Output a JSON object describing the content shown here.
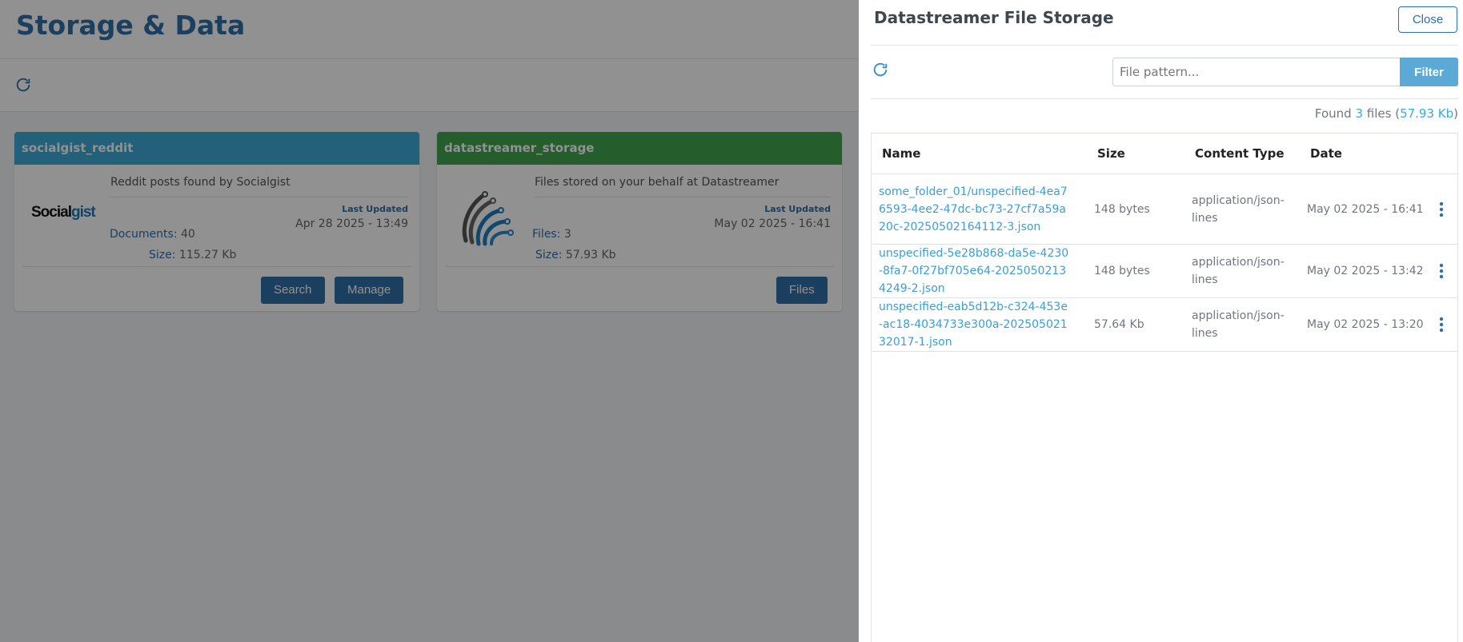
{
  "page": {
    "title": "Storage & Data"
  },
  "cards": [
    {
      "name": "socialgist_reddit",
      "description": "Reddit posts found by Socialgist",
      "logo_text_1": "Social",
      "logo_text_2": "gist",
      "stat1_label": "Documents:",
      "stat1_value": "40",
      "stat2_label": "Size:",
      "stat2_value": "115.27 Kb",
      "updated_label": "Last Updated",
      "updated_value": "Apr 28 2025 - 13:49",
      "buttons": [
        "Search",
        "Manage"
      ]
    },
    {
      "name": "datastreamer_storage",
      "description": "Files stored on your behalf at Datastreamer",
      "stat1_label": "Files:",
      "stat1_value": "3",
      "stat2_label": "Size:",
      "stat2_value": "57.93 Kb",
      "updated_label": "Last Updated",
      "updated_value": "May 02 2025 - 16:41",
      "buttons": [
        "Files"
      ]
    }
  ],
  "panel": {
    "title": "Datastreamer File Storage",
    "close_label": "Close",
    "search_placeholder": "File pattern...",
    "filter_label": "Filter",
    "found_prefix": "Found",
    "found_count": "3",
    "found_mid": "files (",
    "found_size": "57.93 Kb",
    "found_suffix": ")",
    "columns": [
      "Name",
      "Size",
      "Content Type",
      "Date"
    ],
    "rows": [
      {
        "name": "some_folder_01/unspecified-4ea76593-4ee2-47dc-bc73-27cf7a59a20c-20250502164112-3.json",
        "size": "148 bytes",
        "content_type": "application/json-lines",
        "date": "May 02 2025 - 16:41"
      },
      {
        "name": "unspecified-5e28b868-da5e-4230-8fa7-0f27bf705e64-20250502134249-2.json",
        "size": "148 bytes",
        "content_type": "application/json-lines",
        "date": "May 02 2025 - 13:42"
      },
      {
        "name": "unspecified-eab5d12b-c324-453e-ac18-4034733e300a-20250502132017-1.json",
        "size": "57.64 Kb",
        "content_type": "application/json-lines",
        "date": "May 02 2025 - 13:20"
      }
    ]
  },
  "colors": {
    "accent": "#2f6fa8",
    "card1_header": "#3ea9d6",
    "card2_header": "#43a44f",
    "link": "#3a9fd3",
    "filter_button": "#5aa9d6"
  },
  "icons": [
    "refresh-icon",
    "socialgist-logo",
    "datastreamer-logo",
    "kebab-menu-icon"
  ]
}
